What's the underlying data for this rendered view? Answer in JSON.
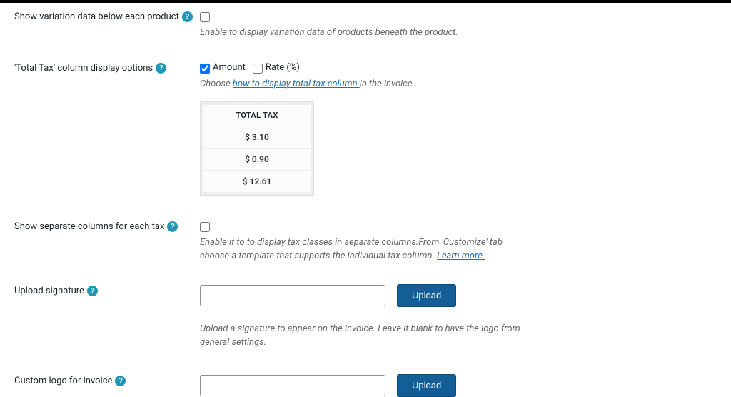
{
  "row_variation": {
    "label": "Show variation data below each product",
    "desc": "Enable to display variation data of products beneath the product."
  },
  "row_total_tax": {
    "label": "'Total Tax' column display options",
    "amount_label": "Amount",
    "rate_label": "Rate (%)",
    "desc_prefix": "Choose ",
    "desc_link": "how to display total tax column ",
    "desc_suffix": "in the invoice",
    "preview_header": "TOTAL TAX",
    "preview_rows": [
      "$ 3.10",
      "$ 0.90",
      "$ 12.61"
    ]
  },
  "row_sep_cols": {
    "label": "Show separate columns for each tax",
    "desc_prefix": "Enable it to to display tax classes in separate columns.From 'Customize' tab choose a template that supports the individual tax column. ",
    "desc_link": "Learn more."
  },
  "row_signature": {
    "label": "Upload signature",
    "btn": "Upload",
    "desc": "Upload a signature to appear on the invoice. Leave it blank to have the logo from general settings."
  },
  "row_logo": {
    "label": "Custom logo for invoice",
    "btn": "Upload"
  },
  "help_char": "?"
}
